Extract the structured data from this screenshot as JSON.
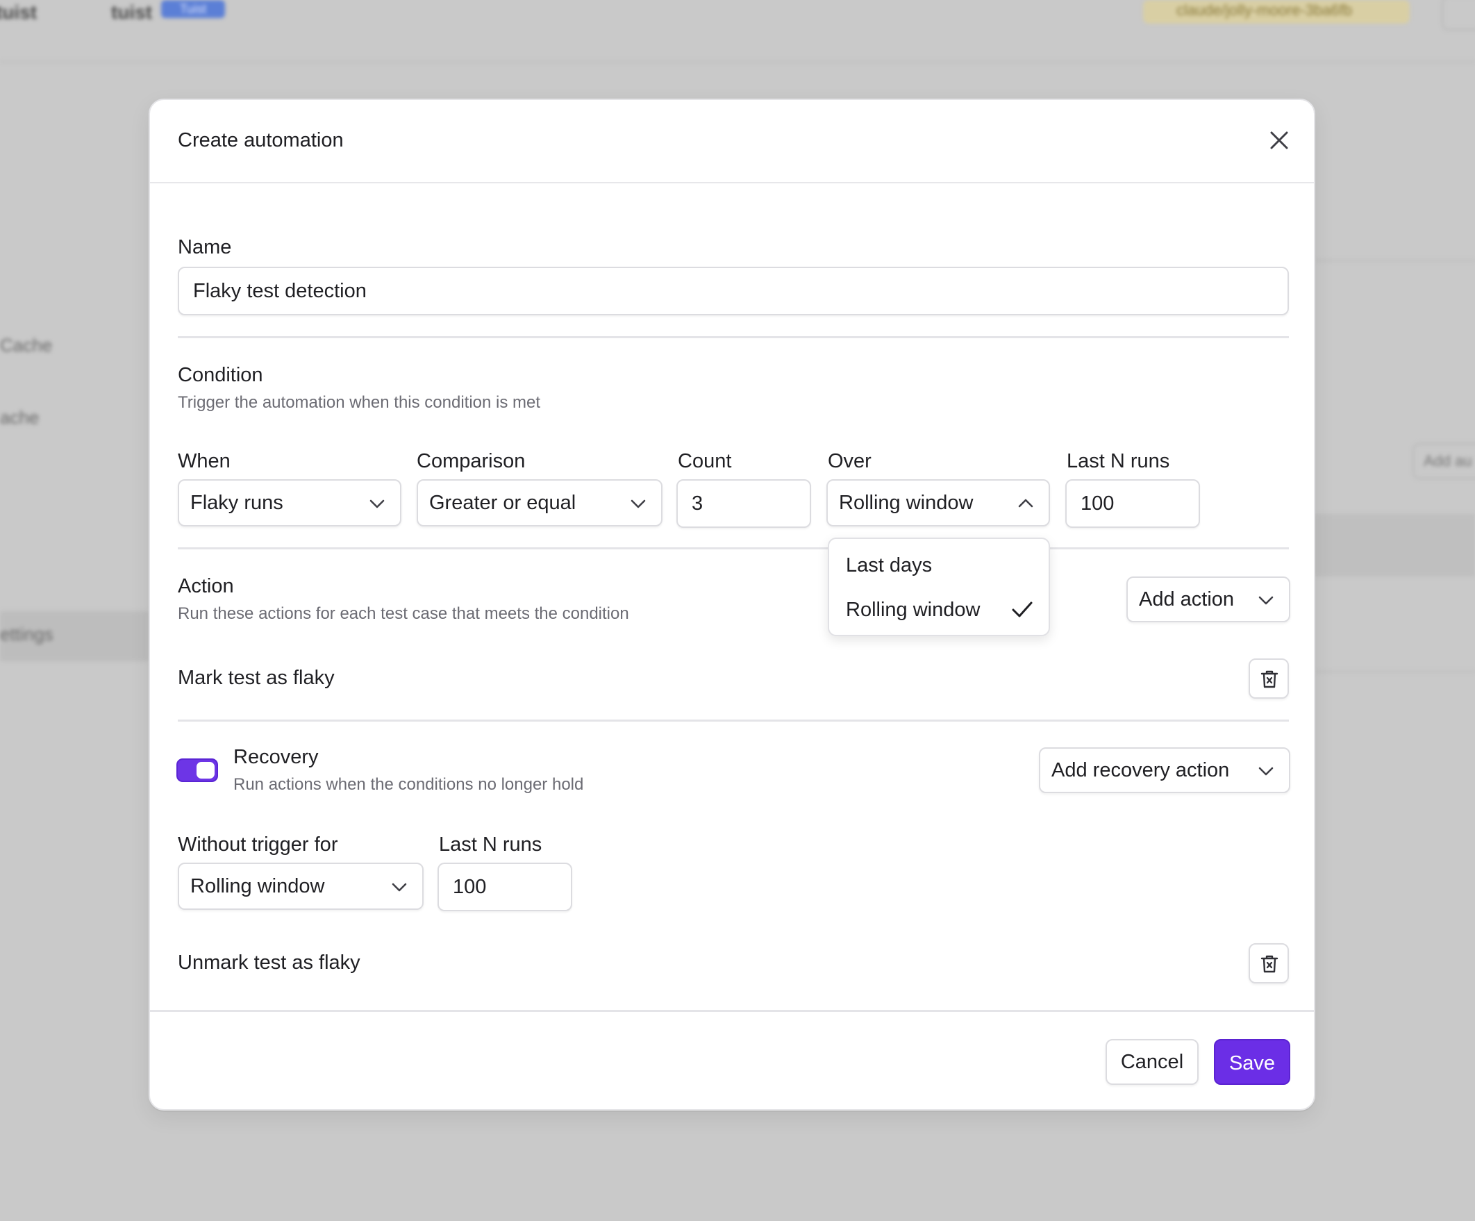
{
  "background": {
    "breadcrumb": [
      "tuist",
      "tuist"
    ],
    "badge": "Tuist",
    "branch": "claude/jolly-moore-3ba6fb",
    "nav_items": [
      "Cache",
      "ache",
      "ettings"
    ],
    "right_button": "Add au"
  },
  "modal": {
    "title": "Create automation",
    "name": {
      "label": "Name",
      "value": "Flaky test detection"
    },
    "condition": {
      "title": "Condition",
      "description": "Trigger the automation when this condition is met",
      "when": {
        "label": "When",
        "value": "Flaky runs"
      },
      "comparison": {
        "label": "Comparison",
        "value": "Greater or equal"
      },
      "count": {
        "label": "Count",
        "value": "3"
      },
      "over": {
        "label": "Over",
        "value": "Rolling window",
        "options": [
          {
            "label": "Last days",
            "selected": false
          },
          {
            "label": "Rolling window",
            "selected": true
          }
        ]
      },
      "last_n_runs": {
        "label": "Last N runs",
        "value": "100"
      }
    },
    "action": {
      "title": "Action",
      "description": "Run these actions for each test case that meets the condition",
      "add_button": "Add action",
      "items": [
        "Mark test as flaky"
      ]
    },
    "recovery": {
      "enabled": true,
      "title": "Recovery",
      "description": "Run actions when the conditions no longer hold",
      "add_button": "Add recovery action",
      "without_trigger_for": {
        "label": "Without trigger for",
        "value": "Rolling window"
      },
      "last_n_runs": {
        "label": "Last N runs",
        "value": "100"
      },
      "items": [
        "Unmark test as flaky"
      ]
    },
    "footer": {
      "cancel_label": "Cancel",
      "save_label": "Save"
    }
  },
  "colors": {
    "accent": "#6b2ee6",
    "overlay": "#c9c9c9",
    "text": "#1f1f23",
    "muted": "#6b6b73",
    "border": "#dcdce0"
  }
}
